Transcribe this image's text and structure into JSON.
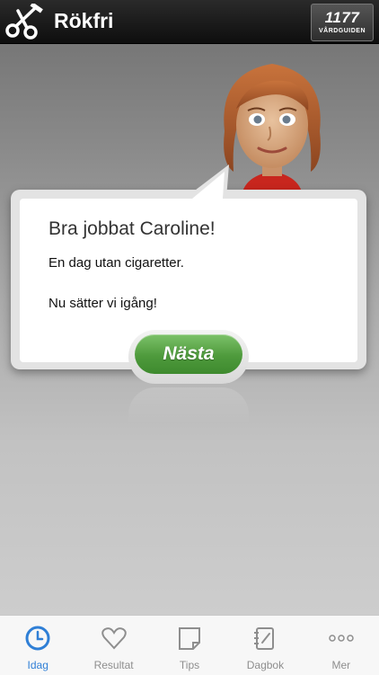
{
  "header": {
    "title": "Rökfri",
    "badge_number": "1177",
    "badge_text": "VÅRDGUIDEN"
  },
  "message": {
    "greeting": "Bra jobbat Caroline!",
    "line1": "En dag utan cigaretter.",
    "line2": "Nu sätter vi igång!",
    "next_label": "Nästa"
  },
  "tabs": [
    {
      "label": "Idag",
      "icon": "clock-icon",
      "active": true
    },
    {
      "label": "Resultat",
      "icon": "heart-icon",
      "active": false
    },
    {
      "label": "Tips",
      "icon": "note-icon",
      "active": false
    },
    {
      "label": "Dagbok",
      "icon": "notebook-icon",
      "active": false
    },
    {
      "label": "Mer",
      "icon": "more-icon",
      "active": false
    }
  ],
  "colors": {
    "accent": "#2f7fd6",
    "button_green": "#4e9a3c",
    "header_bg": "#1a1a1a"
  }
}
